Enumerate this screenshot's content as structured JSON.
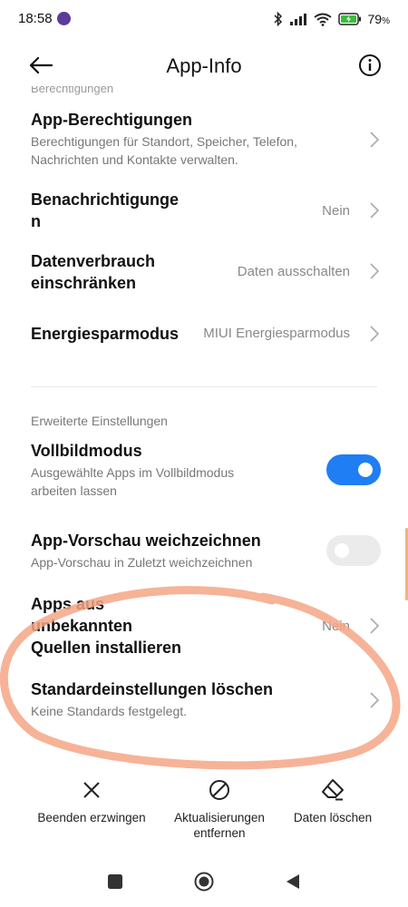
{
  "status_bar": {
    "time": "18:58",
    "battery_percent": "79",
    "battery_unit": "%",
    "icons": [
      "bluetooth-icon",
      "signal-icon",
      "wifi-icon",
      "battery-charging-icon"
    ]
  },
  "header": {
    "title": "App-Info",
    "back_icon": "back-arrow-icon",
    "info_icon": "info-icon"
  },
  "cut_off_label": "Berechtigungen",
  "rows": {
    "permissions": {
      "title": "App-Berechtigungen",
      "subtitle_line1": "Berechtigungen für Standort, Speicher, Telefon,",
      "subtitle_line2": "Nachrichten und Kontakte verwalten."
    },
    "notifications": {
      "title_line1": "Benachrichtigunge",
      "title_line2": "n",
      "value": "Nein"
    },
    "data_usage": {
      "title_line1": "Datenverbrauch",
      "title_line2": "einschränken",
      "value": "Daten ausschalten"
    },
    "battery_saver": {
      "title": "Energiesparmodus",
      "value": "MIUI Energiesparmodus"
    }
  },
  "advanced": {
    "section_title": "Erweiterte Einstellungen",
    "fullscreen": {
      "title": "Vollbildmodus",
      "subtitle_line1": "Ausgewählte Apps im Vollbildmodus",
      "subtitle_line2": "arbeiten lassen",
      "enabled": true
    },
    "blur_preview": {
      "title": "App-Vorschau weichzeichnen",
      "subtitle": "App-Vorschau in Zuletzt weichzeichnen",
      "enabled": false
    },
    "unknown_sources": {
      "title_line1": "Apps aus",
      "title_line2": "unbekannten",
      "title_line3": "Quellen installieren",
      "value": "Nein"
    },
    "clear_defaults": {
      "title": "Standardeinstellungen löschen",
      "subtitle": "Keine Standards festgelegt."
    }
  },
  "actions": {
    "force_stop": {
      "label": "Beenden erzwingen",
      "icon": "close-icon"
    },
    "uninstall_updates": {
      "label_line1": "Aktualisierungen",
      "label_line2": "entfernen",
      "icon": "block-icon"
    },
    "clear_data": {
      "label": "Daten löschen",
      "icon": "eraser-icon"
    }
  },
  "colors": {
    "toggle_on": "#1f7ef4",
    "toggle_off": "#ebebeb",
    "annotation": "#f4a685",
    "secondary_text": "#777777"
  }
}
